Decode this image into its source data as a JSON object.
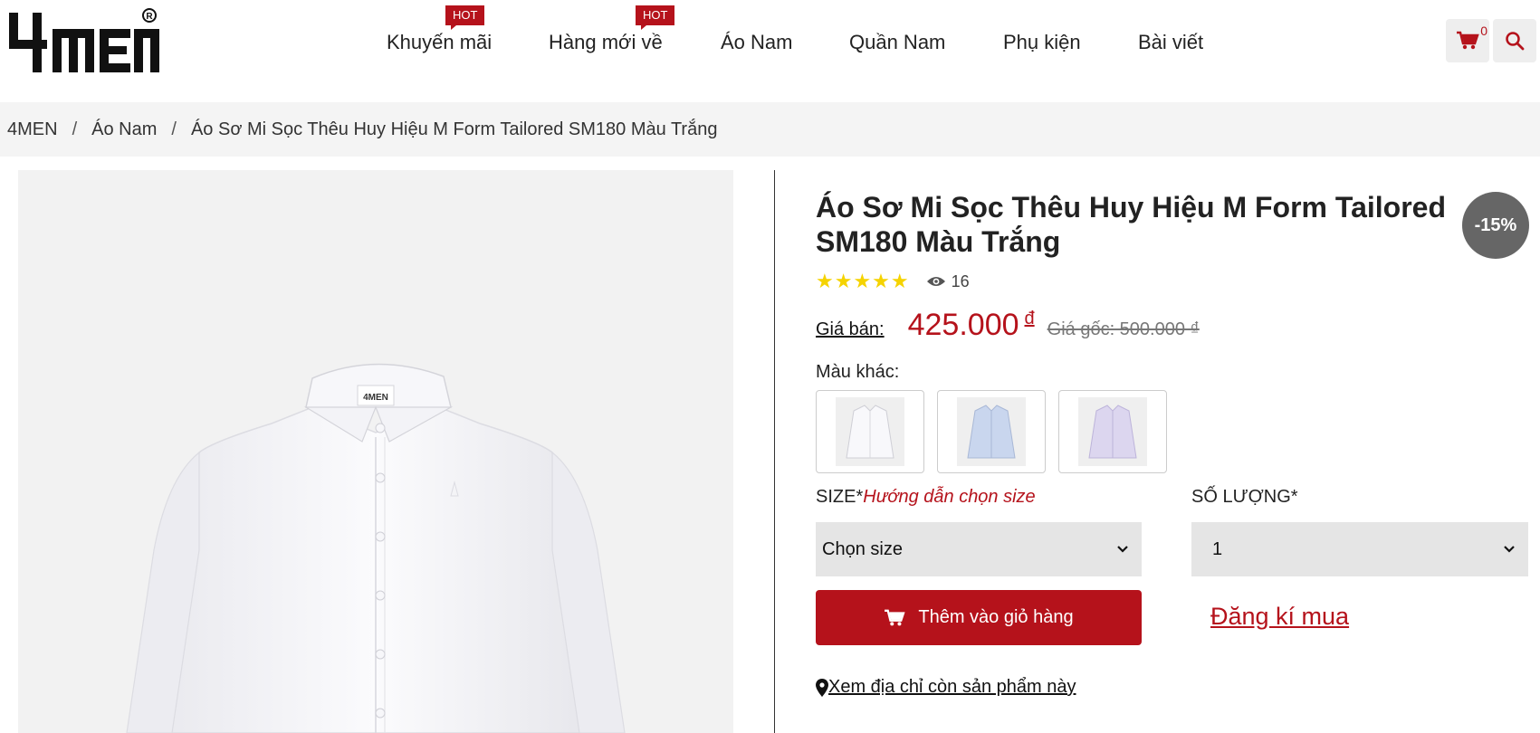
{
  "header": {
    "logo_text": "4MEN",
    "nav": [
      {
        "label": "Khuyến mãi",
        "badge": "HOT"
      },
      {
        "label": "Hàng mới về",
        "badge": "HOT"
      },
      {
        "label": "Áo Nam"
      },
      {
        "label": "Quần Nam"
      },
      {
        "label": "Phụ kiện"
      },
      {
        "label": "Bài viết"
      }
    ],
    "cart_count": "0",
    "icons": [
      "cart-icon",
      "search-icon"
    ]
  },
  "breadcrumb": [
    "4MEN",
    "Áo Nam",
    "Áo Sơ Mi Sọc Thêu Huy Hiệu M Form Tailored SM180 Màu Trắng"
  ],
  "product": {
    "title": "Áo Sơ Mi Sọc Thêu Huy Hiệu M Form Tailored SM180 Màu Trắng",
    "discount": "-15%",
    "rating_stars": 5,
    "views": "16",
    "price_label": "Giá bán:",
    "price": "425.000",
    "currency": "đ",
    "old_price": "Giá gốc: 500.000 ₫",
    "colors_label": "Màu khác:",
    "color_swatches": [
      "white",
      "light-blue",
      "lavender"
    ],
    "size_label": "SIZE*",
    "size_guide": "Hướng dẫn chọn size",
    "qty_label": "SỐ LƯỢNG*",
    "size_select": "Chọn size",
    "qty_select": "1",
    "add_to_cart": "Thêm vào giỏ hàng",
    "register": "Đăng kí mua",
    "store_link": "Xem địa chỉ còn sản phẩm này"
  },
  "colors": {
    "brand_red": "#b5121b",
    "star_yellow": "#f5d300",
    "badge_gray": "#666666"
  }
}
